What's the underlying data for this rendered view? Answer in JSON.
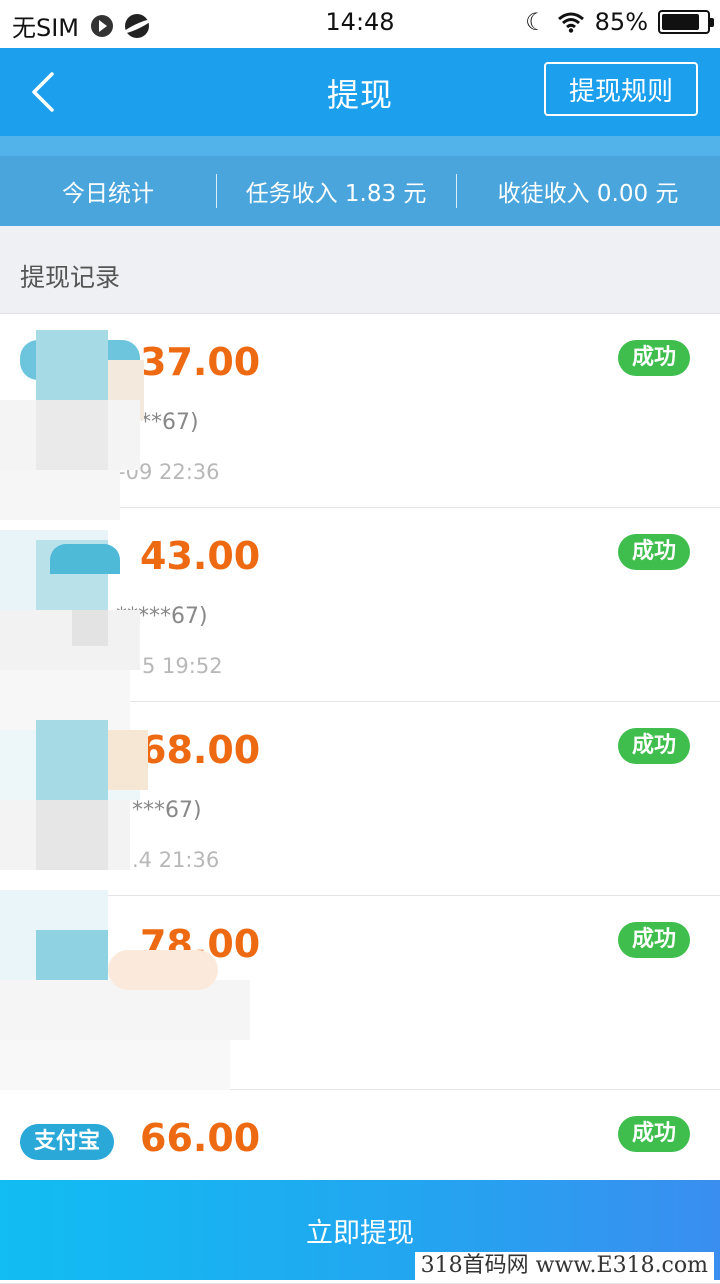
{
  "status_bar": {
    "carrier": "无SIM",
    "time": "14:48",
    "battery": "85%",
    "icons": [
      "play-icon",
      "planet-icon",
      "moon-icon",
      "wifi-icon",
      "battery-icon"
    ]
  },
  "header": {
    "title": "提现",
    "rules_button": "提现规则",
    "back_icon": "chevron-left-icon"
  },
  "stats": {
    "today": "今日统计",
    "task_income": "任务收入 1.83 元",
    "apprentice_income": "收徒收入 0.00 元"
  },
  "records": {
    "title": "提现记录",
    "items": [
      {
        "pay_method": "",
        "amount": "37.00",
        "account": "**67)",
        "time": "-09 22:36",
        "status": "成功"
      },
      {
        "pay_method": "",
        "amount": "43.00",
        "account": "*****67)",
        "time": "5 19:52",
        "status": "成功"
      },
      {
        "pay_method": "",
        "amount": "68.00",
        "account": "***67)",
        "time": ".4 21:36",
        "status": "成功"
      },
      {
        "pay_method": "",
        "amount": "78.00",
        "account": "",
        "time": "",
        "status": "成功"
      },
      {
        "pay_method": "支付宝",
        "amount": "66.00",
        "account": "",
        "time": "",
        "status": "成功"
      }
    ]
  },
  "footer": {
    "withdraw_button": "立即提现",
    "watermark": "318首码网  www.E318.com"
  },
  "colors": {
    "primary": "#1ca0ee",
    "amount": "#ee6a12",
    "success": "#3fbe4e",
    "alipay": "#2aa8d8"
  }
}
